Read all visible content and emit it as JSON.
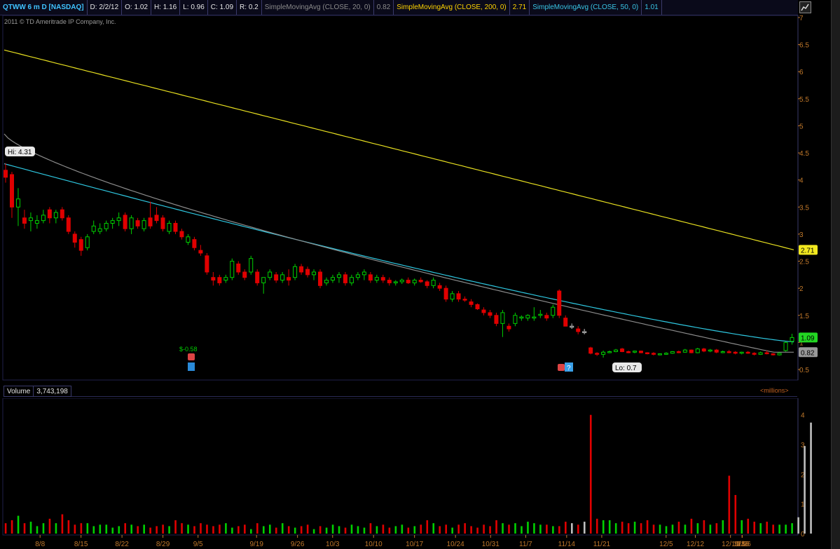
{
  "header": {
    "symbol": "QTWW 6 m D [NASDAQ]",
    "date": "D: 2/2/12",
    "open": "O: 1.02",
    "high": "H: 1.16",
    "low": "L: 0.96",
    "close": "C: 1.09",
    "range": "R: 0.2",
    "sma20_label": "SimpleMovingAvg (CLOSE, 20, 0)",
    "sma20_value": "0.82",
    "sma200_label": "SimpleMovingAvg (CLOSE, 200, 0)",
    "sma200_value": "2.71",
    "sma50_label": "SimpleMovingAvg (CLOSE, 50, 0)",
    "sma50_value": "1.01"
  },
  "copyright": "2011 © TD Ameritrade IP Company, Inc.",
  "labels": {
    "hi": "Hi: 4.31",
    "lo": "Lo: 0.7",
    "dividend": "$-0.58",
    "sma200_tag": "2.71",
    "price_tag": "1.09",
    "sma20_tag": "0.82"
  },
  "volume": {
    "label": "Volume",
    "value": "3,743,198",
    "units": "<millions>"
  },
  "colors": {
    "up": "#00d000",
    "down": "#e00000",
    "sma20": "#8c8c8c",
    "sma50": "#2ec7e0",
    "sma200": "#e8e020",
    "axis_text": "#c0782a",
    "flat": "#bfbfbf"
  },
  "icons": {
    "alert": "phone-icon",
    "earnings": "earnings-icon",
    "unknown": "question-icon"
  },
  "chart_data": [
    {
      "type": "candlestick",
      "title": "QTWW 6 m D [NASDAQ]",
      "xlabel": "",
      "ylabel": "",
      "ylim": [
        0.5,
        7
      ],
      "y_ticks": [
        "7",
        "6.5",
        "6",
        "5.5",
        "5",
        "4.5",
        "4",
        "3.5",
        "3",
        "2.5",
        "2",
        "1.5",
        "1",
        "0.5"
      ],
      "x_ticks": [
        "8/8",
        "8/15",
        "8/22",
        "8/29",
        "9/5",
        "9/19",
        "9/26",
        "10/3",
        "10/10",
        "10/17",
        "10/24",
        "10/31",
        "11/7",
        "11/14",
        "11/21",
        "12/5",
        "12/12",
        "12/19",
        "12/26",
        "1/9",
        "1/16",
        "1/30"
      ],
      "candles": [
        [
          4.18,
          4.31,
          3.95,
          4.05
        ],
        [
          4.1,
          4.15,
          3.3,
          3.5
        ],
        [
          3.5,
          3.85,
          3.15,
          3.65
        ],
        [
          3.3,
          3.45,
          3.1,
          3.2
        ],
        [
          3.25,
          3.4,
          3.05,
          3.3
        ],
        [
          3.2,
          3.35,
          3.1,
          3.25
        ],
        [
          3.25,
          3.45,
          3.2,
          3.35
        ],
        [
          3.45,
          3.5,
          3.2,
          3.3
        ],
        [
          3.3,
          3.45,
          3.2,
          3.4
        ],
        [
          3.45,
          3.5,
          3.25,
          3.3
        ],
        [
          3.3,
          3.35,
          3.0,
          3.05
        ],
        [
          3.0,
          3.05,
          2.75,
          2.85
        ],
        [
          2.9,
          2.95,
          2.6,
          2.7
        ],
        [
          2.75,
          3.0,
          2.7,
          2.95
        ],
        [
          3.05,
          3.25,
          3.0,
          3.15
        ],
        [
          3.05,
          3.2,
          3.0,
          3.1
        ],
        [
          3.1,
          3.25,
          3.05,
          3.2
        ],
        [
          3.2,
          3.3,
          3.1,
          3.25
        ],
        [
          3.25,
          3.4,
          3.15,
          3.3
        ],
        [
          3.35,
          3.4,
          3.05,
          3.1
        ],
        [
          3.1,
          3.35,
          3.0,
          3.3
        ],
        [
          3.25,
          3.3,
          3.1,
          3.15
        ],
        [
          3.1,
          3.3,
          3.05,
          3.25
        ],
        [
          3.3,
          3.6,
          3.1,
          3.15
        ],
        [
          3.35,
          3.5,
          3.2,
          3.25
        ],
        [
          3.3,
          3.35,
          3.05,
          3.1
        ],
        [
          3.05,
          3.25,
          3.0,
          3.2
        ],
        [
          3.2,
          3.25,
          3.0,
          3.05
        ],
        [
          3.05,
          3.1,
          2.9,
          2.95
        ],
        [
          2.85,
          3.0,
          2.8,
          2.95
        ],
        [
          2.9,
          2.95,
          2.7,
          2.75
        ],
        [
          2.7,
          2.8,
          2.6,
          2.65
        ],
        [
          2.6,
          2.65,
          2.25,
          2.3
        ],
        [
          2.2,
          2.3,
          2.05,
          2.15
        ],
        [
          2.2,
          2.25,
          2.05,
          2.1
        ],
        [
          2.15,
          2.25,
          2.1,
          2.2
        ],
        [
          2.2,
          2.55,
          2.15,
          2.5
        ],
        [
          2.45,
          2.5,
          2.25,
          2.3
        ],
        [
          2.3,
          2.35,
          2.15,
          2.2
        ],
        [
          2.3,
          2.6,
          2.25,
          2.55
        ],
        [
          2.3,
          2.35,
          2.05,
          2.1
        ],
        [
          2.1,
          2.15,
          1.9,
          2.2
        ],
        [
          2.2,
          2.35,
          2.15,
          2.3
        ],
        [
          2.25,
          2.3,
          2.1,
          2.15
        ],
        [
          2.15,
          2.3,
          2.1,
          2.25
        ],
        [
          2.2,
          2.35,
          2.05,
          2.15
        ],
        [
          2.2,
          2.45,
          2.15,
          2.4
        ],
        [
          2.4,
          2.45,
          2.25,
          2.3
        ],
        [
          2.35,
          2.4,
          2.2,
          2.25
        ],
        [
          2.25,
          2.35,
          2.15,
          2.3
        ],
        [
          2.3,
          2.35,
          2.0,
          2.05
        ],
        [
          2.1,
          2.2,
          2.05,
          2.15
        ],
        [
          2.15,
          2.25,
          2.1,
          2.2
        ],
        [
          2.2,
          2.3,
          2.1,
          2.25
        ],
        [
          2.25,
          2.3,
          2.05,
          2.1
        ],
        [
          2.1,
          2.25,
          2.05,
          2.2
        ],
        [
          2.2,
          2.3,
          2.15,
          2.25
        ],
        [
          2.25,
          2.35,
          2.15,
          2.3
        ],
        [
          2.25,
          2.3,
          2.1,
          2.15
        ],
        [
          2.15,
          2.25,
          2.1,
          2.2
        ],
        [
          2.2,
          2.25,
          2.1,
          2.15
        ],
        [
          2.15,
          2.2,
          2.05,
          2.1
        ],
        [
          2.1,
          2.15,
          2.05,
          2.12
        ],
        [
          2.12,
          2.18,
          2.08,
          2.15
        ],
        [
          2.15,
          2.2,
          2.08,
          2.1
        ],
        [
          2.1,
          2.18,
          2.05,
          2.15
        ],
        [
          2.15,
          2.2,
          2.1,
          2.12
        ],
        [
          2.12,
          2.15,
          2.0,
          2.05
        ],
        [
          2.05,
          2.2,
          2.0,
          2.15
        ],
        [
          2.05,
          2.1,
          1.95,
          2.0
        ],
        [
          2.0,
          2.05,
          1.75,
          1.8
        ],
        [
          1.8,
          1.95,
          1.75,
          1.9
        ],
        [
          1.9,
          1.95,
          1.75,
          1.8
        ],
        [
          1.8,
          1.85,
          1.75,
          1.78
        ],
        [
          1.75,
          1.8,
          1.65,
          1.7
        ],
        [
          1.7,
          1.72,
          1.6,
          1.62
        ],
        [
          1.6,
          1.65,
          1.5,
          1.55
        ],
        [
          1.55,
          1.6,
          1.45,
          1.5
        ],
        [
          1.5,
          1.55,
          1.3,
          1.35
        ],
        [
          1.35,
          1.6,
          1.1,
          1.55
        ],
        [
          1.3,
          1.35,
          1.2,
          1.25
        ],
        [
          1.35,
          1.55,
          1.3,
          1.5
        ],
        [
          1.45,
          1.5,
          1.4,
          1.47
        ],
        [
          1.45,
          1.52,
          1.4,
          1.5
        ],
        [
          1.45,
          1.65,
          1.4,
          1.47
        ],
        [
          1.5,
          1.6,
          1.45,
          1.52
        ],
        [
          1.5,
          1.55,
          1.4,
          1.45
        ],
        [
          1.5,
          1.7,
          1.45,
          1.65
        ],
        [
          1.95,
          1.98,
          1.45,
          1.5
        ],
        [
          1.45,
          1.5,
          1.3,
          1.3
        ],
        [
          1.3,
          1.35,
          1.25,
          1.3
        ],
        [
          1.25,
          1.3,
          1.15,
          1.2
        ],
        [
          1.2,
          1.25,
          1.15,
          1.2
        ],
        [
          0.9,
          0.92,
          0.78,
          0.8
        ],
        [
          0.8,
          0.82,
          0.75,
          0.78
        ],
        [
          0.78,
          0.85,
          0.72,
          0.82
        ],
        [
          0.82,
          0.85,
          0.8,
          0.83
        ],
        [
          0.83,
          0.88,
          0.82,
          0.86
        ],
        [
          0.88,
          0.9,
          0.82,
          0.83
        ],
        [
          0.83,
          0.85,
          0.8,
          0.82
        ],
        [
          0.82,
          0.85,
          0.8,
          0.84
        ],
        [
          0.84,
          0.85,
          0.8,
          0.81
        ],
        [
          0.81,
          0.82,
          0.78,
          0.8
        ],
        [
          0.8,
          0.82,
          0.76,
          0.78
        ],
        [
          0.78,
          0.8,
          0.76,
          0.79
        ],
        [
          0.79,
          0.82,
          0.77,
          0.8
        ],
        [
          0.8,
          0.84,
          0.79,
          0.83
        ],
        [
          0.83,
          0.85,
          0.8,
          0.82
        ],
        [
          0.82,
          0.88,
          0.81,
          0.86
        ],
        [
          0.86,
          0.87,
          0.8,
          0.81
        ],
        [
          0.81,
          0.9,
          0.8,
          0.88
        ],
        [
          0.88,
          0.9,
          0.82,
          0.84
        ],
        [
          0.84,
          0.88,
          0.82,
          0.86
        ],
        [
          0.86,
          0.88,
          0.8,
          0.82
        ],
        [
          0.82,
          0.85,
          0.8,
          0.83
        ],
        [
          0.83,
          0.86,
          0.8,
          0.82
        ],
        [
          0.82,
          0.84,
          0.78,
          0.8
        ],
        [
          0.8,
          0.83,
          0.78,
          0.82
        ],
        [
          0.82,
          0.84,
          0.79,
          0.8
        ],
        [
          0.8,
          0.82,
          0.76,
          0.78
        ],
        [
          0.78,
          0.83,
          0.77,
          0.81
        ],
        [
          0.81,
          0.85,
          0.78,
          0.79
        ],
        [
          0.79,
          0.8,
          0.76,
          0.77
        ],
        [
          0.77,
          0.82,
          0.76,
          0.8
        ],
        [
          0.85,
          1.02,
          0.83,
          1.0
        ],
        [
          1.02,
          1.16,
          0.96,
          1.09
        ]
      ],
      "series": [
        {
          "name": "SimpleMovingAvg (CLOSE, 200, 0)",
          "color": "#e8e020",
          "y_start": 6.4,
          "y_end": 2.71
        },
        {
          "name": "SimpleMovingAvg (CLOSE, 50, 0)",
          "color": "#2ec7e0",
          "y_start": 4.3,
          "y_end": 1.01
        },
        {
          "name": "SimpleMovingAvg (CLOSE, 20, 0)",
          "color": "#8c8c8c",
          "y_start": 4.85,
          "y_end": 0.82
        }
      ]
    },
    {
      "type": "bar",
      "title": "Volume",
      "ylim": [
        0,
        4.3
      ],
      "y_ticks": [
        "4",
        "3",
        "2",
        "1",
        "0"
      ],
      "units": "millions",
      "values": [
        0.35,
        0.45,
        0.6,
        0.35,
        0.4,
        0.25,
        0.35,
        0.5,
        0.35,
        0.65,
        0.45,
        0.3,
        0.35,
        0.35,
        0.25,
        0.3,
        0.3,
        0.2,
        0.25,
        0.35,
        0.3,
        0.25,
        0.3,
        0.2,
        0.25,
        0.3,
        0.25,
        0.45,
        0.35,
        0.3,
        0.25,
        0.35,
        0.3,
        0.25,
        0.3,
        0.35,
        0.2,
        0.25,
        0.3,
        0.15,
        0.35,
        0.25,
        0.3,
        0.2,
        0.35,
        0.25,
        0.2,
        0.25,
        0.3,
        0.15,
        0.25,
        0.2,
        0.3,
        0.25,
        0.2,
        0.3,
        0.25,
        0.2,
        0.35,
        0.25,
        0.3,
        0.2,
        0.25,
        0.3,
        0.2,
        0.25,
        0.3,
        0.45,
        0.35,
        0.25,
        0.3,
        0.2,
        0.3,
        0.35,
        0.25,
        0.2,
        0.3,
        0.25,
        0.45,
        0.35,
        0.3,
        0.35,
        0.25,
        0.4,
        0.35,
        0.3,
        0.3,
        0.25,
        0.25,
        0.4,
        0.35,
        0.3,
        0.4,
        4.0,
        0.5,
        0.45,
        0.45,
        0.35,
        0.4,
        0.35,
        0.4,
        0.35,
        0.45,
        0.3,
        0.3,
        0.25,
        0.3,
        0.4,
        0.3,
        0.5,
        0.35,
        0.45,
        0.3,
        0.35,
        0.45,
        1.95,
        1.3,
        0.45,
        0.5,
        0.4,
        0.35,
        0.4,
        0.3,
        0.3,
        0.3,
        0.35,
        0.55,
        2.95,
        3.74
      ]
    }
  ]
}
